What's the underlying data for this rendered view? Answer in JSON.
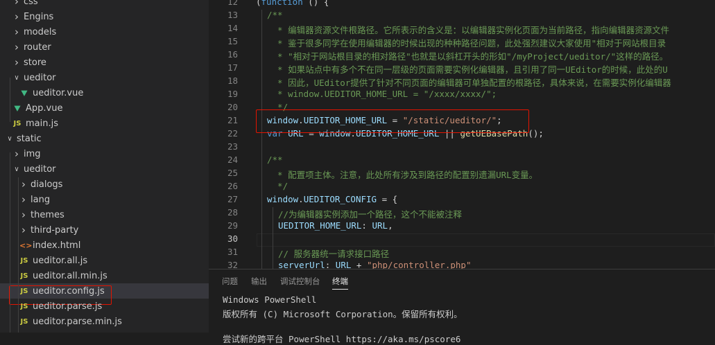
{
  "explorer": {
    "items": [
      {
        "label": "css",
        "kind": "folder",
        "state": "collapsed",
        "depth": 1,
        "icon": "chevron-right-icon"
      },
      {
        "label": "Engins",
        "kind": "folder",
        "state": "collapsed",
        "depth": 1,
        "icon": "chevron-right-icon"
      },
      {
        "label": "models",
        "kind": "folder",
        "state": "collapsed",
        "depth": 1,
        "icon": "chevron-right-icon"
      },
      {
        "label": "router",
        "kind": "folder",
        "state": "collapsed",
        "depth": 1,
        "icon": "chevron-right-icon"
      },
      {
        "label": "store",
        "kind": "folder",
        "state": "collapsed",
        "depth": 1,
        "icon": "chevron-right-icon"
      },
      {
        "label": "ueditor",
        "kind": "folder",
        "state": "expanded",
        "depth": 1,
        "icon": "chevron-down-icon"
      },
      {
        "label": "ueditor.vue",
        "kind": "vue",
        "depth": 2,
        "icon": "vue-file-icon"
      },
      {
        "label": "App.vue",
        "kind": "vue",
        "depth": 1,
        "icon": "vue-file-icon"
      },
      {
        "label": "main.js",
        "kind": "js",
        "depth": 1,
        "icon": "js-file-icon"
      },
      {
        "label": "static",
        "kind": "folder",
        "state": "expanded",
        "depth": 0,
        "icon": "chevron-down-icon"
      },
      {
        "label": "img",
        "kind": "folder",
        "state": "collapsed",
        "depth": 1,
        "icon": "chevron-right-icon"
      },
      {
        "label": "ueditor",
        "kind": "folder",
        "state": "expanded",
        "depth": 1,
        "icon": "chevron-down-icon"
      },
      {
        "label": "dialogs",
        "kind": "folder",
        "state": "collapsed",
        "depth": 2,
        "icon": "chevron-right-icon"
      },
      {
        "label": "lang",
        "kind": "folder",
        "state": "collapsed",
        "depth": 2,
        "icon": "chevron-right-icon"
      },
      {
        "label": "themes",
        "kind": "folder",
        "state": "collapsed",
        "depth": 2,
        "icon": "chevron-right-icon"
      },
      {
        "label": "third-party",
        "kind": "folder",
        "state": "collapsed",
        "depth": 2,
        "icon": "chevron-right-icon"
      },
      {
        "label": "index.html",
        "kind": "html",
        "depth": 2,
        "icon": "html-file-icon"
      },
      {
        "label": "ueditor.all.js",
        "kind": "js",
        "depth": 2,
        "icon": "js-file-icon"
      },
      {
        "label": "ueditor.all.min.js",
        "kind": "js",
        "depth": 2,
        "icon": "js-file-icon"
      },
      {
        "label": "ueditor.config.js",
        "kind": "js",
        "depth": 2,
        "icon": "js-file-icon",
        "selected": true,
        "highlighted": true
      },
      {
        "label": "ueditor.parse.js",
        "kind": "js",
        "depth": 2,
        "icon": "js-file-icon"
      },
      {
        "label": "ueditor.parse.min.js",
        "kind": "js",
        "depth": 2,
        "icon": "js-file-icon"
      }
    ],
    "file_badge_js": "JS",
    "file_badge_vue": "V",
    "file_badge_html": "<>"
  },
  "editor": {
    "active_line": 30,
    "highlighted_line": 21,
    "lines": [
      {
        "n": "12",
        "indent": 0,
        "tokens": [
          [
            "pl",
            "("
          ],
          [
            "kw",
            "function"
          ],
          [
            "pl",
            " () {"
          ]
        ]
      },
      {
        "n": "13",
        "indent": 1,
        "tokens": [
          [
            "cm",
            "/**"
          ]
        ]
      },
      {
        "n": "14",
        "indent": 1,
        "tokens": [
          [
            "cm",
            "  * 编辑器资源文件根路径。它所表示的含义是：以编辑器实例化页面为当前路径，指向编辑器资源文件"
          ]
        ]
      },
      {
        "n": "15",
        "indent": 1,
        "tokens": [
          [
            "cm",
            "  * 鉴于很多同学在使用编辑器的时候出现的种种路径问题，此处强烈建议大家使用\"相对于网站根目录"
          ]
        ]
      },
      {
        "n": "16",
        "indent": 1,
        "tokens": [
          [
            "cm",
            "  * \"相对于网站根目录的相对路径\"也就是以斜杠开头的形如\"/myProject/ueditor/\"这样的路径。"
          ]
        ]
      },
      {
        "n": "17",
        "indent": 1,
        "tokens": [
          [
            "cm",
            "  * 如果站点中有多个不在同一层级的页面需要实例化编辑器，且引用了同一UEditor的时候，此处的U"
          ]
        ]
      },
      {
        "n": "18",
        "indent": 1,
        "tokens": [
          [
            "cm",
            "  * 因此，UEditor提供了针对不同页面的编辑器可单独配置的根路径，具体来说，在需要实例化编辑器"
          ]
        ]
      },
      {
        "n": "19",
        "indent": 1,
        "tokens": [
          [
            "cm",
            "  * window.UEDITOR_HOME_URL = \"/xxxx/xxxx/\";"
          ]
        ]
      },
      {
        "n": "20",
        "indent": 1,
        "tokens": [
          [
            "cm",
            "  */"
          ]
        ]
      },
      {
        "n": "21",
        "indent": 1,
        "tokens": [
          [
            "var",
            "window"
          ],
          [
            "pl",
            "."
          ],
          [
            "var",
            "UEDITOR_HOME_URL"
          ],
          [
            "pl",
            " = "
          ],
          [
            "str",
            "\"/static/ueditor/\""
          ],
          [
            "pl",
            ";"
          ]
        ]
      },
      {
        "n": "22",
        "indent": 1,
        "tokens": [
          [
            "kw",
            "var"
          ],
          [
            "pl",
            " "
          ],
          [
            "var",
            "URL"
          ],
          [
            "pl",
            " = "
          ],
          [
            "var",
            "window"
          ],
          [
            "pl",
            "."
          ],
          [
            "var",
            "UEDITOR_HOME_URL"
          ],
          [
            "pl",
            " || "
          ],
          [
            "fn",
            "getUEBasePath"
          ],
          [
            "pl",
            "();"
          ]
        ]
      },
      {
        "n": "23",
        "indent": 1,
        "tokens": []
      },
      {
        "n": "24",
        "indent": 1,
        "tokens": [
          [
            "cm",
            "/**"
          ]
        ]
      },
      {
        "n": "25",
        "indent": 1,
        "tokens": [
          [
            "cm",
            "  * 配置项主体。注意，此处所有涉及到路径的配置别遗漏URL变量。"
          ]
        ]
      },
      {
        "n": "26",
        "indent": 1,
        "tokens": [
          [
            "cm",
            "  */"
          ]
        ]
      },
      {
        "n": "27",
        "indent": 1,
        "tokens": [
          [
            "var",
            "window"
          ],
          [
            "pl",
            "."
          ],
          [
            "var",
            "UEDITOR_CONFIG"
          ],
          [
            "pl",
            " = {"
          ]
        ]
      },
      {
        "n": "28",
        "indent": 2,
        "tokens": [
          [
            "cm",
            "//为编辑器实例添加一个路径，这个不能被注释"
          ]
        ]
      },
      {
        "n": "29",
        "indent": 2,
        "tokens": [
          [
            "var",
            "UEDITOR_HOME_URL"
          ],
          [
            "pl",
            ": "
          ],
          [
            "var",
            "URL"
          ],
          [
            "pl",
            ","
          ]
        ]
      },
      {
        "n": "30",
        "indent": 2,
        "tokens": []
      },
      {
        "n": "31",
        "indent": 2,
        "tokens": [
          [
            "cm",
            "// 服务器统一请求接口路径"
          ]
        ]
      },
      {
        "n": "32",
        "indent": 2,
        "tokens": [
          [
            "var",
            "serverUrl"
          ],
          [
            "pl",
            ": "
          ],
          [
            "var",
            "URL"
          ],
          [
            "pl",
            " + "
          ],
          [
            "str",
            "\"php/controller.php\""
          ]
        ]
      }
    ]
  },
  "panel": {
    "tabs": [
      {
        "label": "问题",
        "active": false
      },
      {
        "label": "输出",
        "active": false
      },
      {
        "label": "调试控制台",
        "active": false
      },
      {
        "label": "终端",
        "active": true
      }
    ],
    "terminal_lines": [
      "Windows PowerShell",
      "版权所有 (C) Microsoft Corporation。保留所有权利。",
      "",
      "尝试新的跨平台 PowerShell https://aka.ms/pscore6"
    ]
  },
  "colors": {
    "highlight_box": "#e51400",
    "sidebar_bg": "#252526",
    "editor_bg": "#1e1e1e"
  }
}
